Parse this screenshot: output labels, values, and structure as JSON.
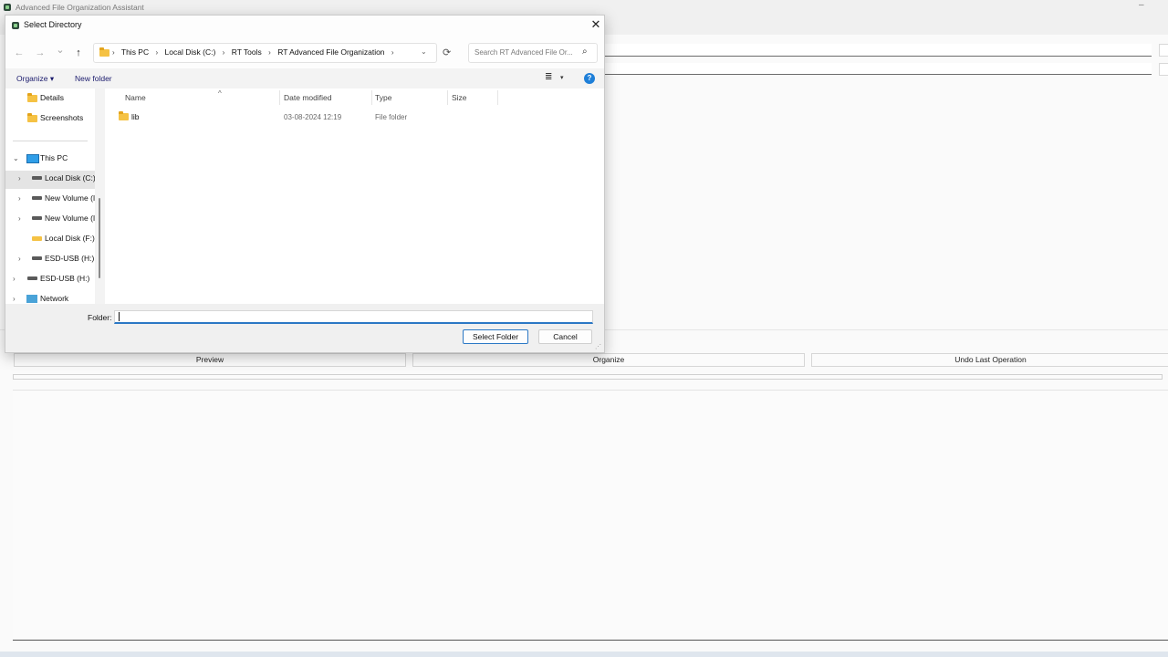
{
  "app": {
    "title": "Advanced File Organization Assistant",
    "minimize_glyph": "–",
    "buttons": {
      "preview": "Preview",
      "organize": "Organize",
      "undo": "Undo Last Operation"
    }
  },
  "dialog": {
    "title": "Select Directory",
    "close_glyph": "✕",
    "nav": {
      "back": "←",
      "forward": "→",
      "recent": "⌄",
      "up": "↑"
    },
    "breadcrumbs": [
      "This PC",
      "Local Disk (C:)",
      "RT Tools",
      "RT Advanced File Organization"
    ],
    "crumb_sep": "›",
    "address_dropdown": "⌄",
    "refresh_glyph": "⟳",
    "search": {
      "placeholder": "Search RT Advanced File Or...",
      "icon": "⌕"
    },
    "toolbar": {
      "organize": "Organize ▾",
      "new_folder": "New folder",
      "view_glyph": "≣",
      "view_dd": "▾",
      "help": "?"
    },
    "nav_pane": {
      "items": [
        {
          "label": "Details",
          "icon": "folder-icon"
        },
        {
          "label": "Screenshots",
          "icon": "folder-icon"
        },
        {
          "label": "This PC",
          "icon": "pc-icon",
          "chevron": "⌄"
        },
        {
          "label": "Local Disk (C:)",
          "icon": "drive-icon",
          "chevron": "›"
        },
        {
          "label": "New Volume (I",
          "icon": "drive-icon",
          "chevron": "›"
        },
        {
          "label": "New Volume (I",
          "icon": "drive-icon",
          "chevron": "›"
        },
        {
          "label": "Local Disk (F:)",
          "icon": "drive-icon"
        },
        {
          "label": "ESD-USB (H:)",
          "icon": "usb-icon",
          "chevron": "›"
        },
        {
          "label": "ESD-USB (H:)",
          "icon": "usb-icon",
          "chevron": "›"
        },
        {
          "label": "Network",
          "icon": "network-icon",
          "chevron": "›"
        }
      ]
    },
    "columns": {
      "name": "Name",
      "date": "Date modified",
      "type": "Type",
      "size": "Size",
      "sort_glyph": "^"
    },
    "files": [
      {
        "name": "lib",
        "date": "03-08-2024 12:19",
        "type": "File folder"
      }
    ],
    "footer": {
      "folder_label": "Folder:",
      "folder_value": "",
      "select_button": "Select Folder",
      "cancel_button": "Cancel",
      "grip": "⋰"
    }
  }
}
